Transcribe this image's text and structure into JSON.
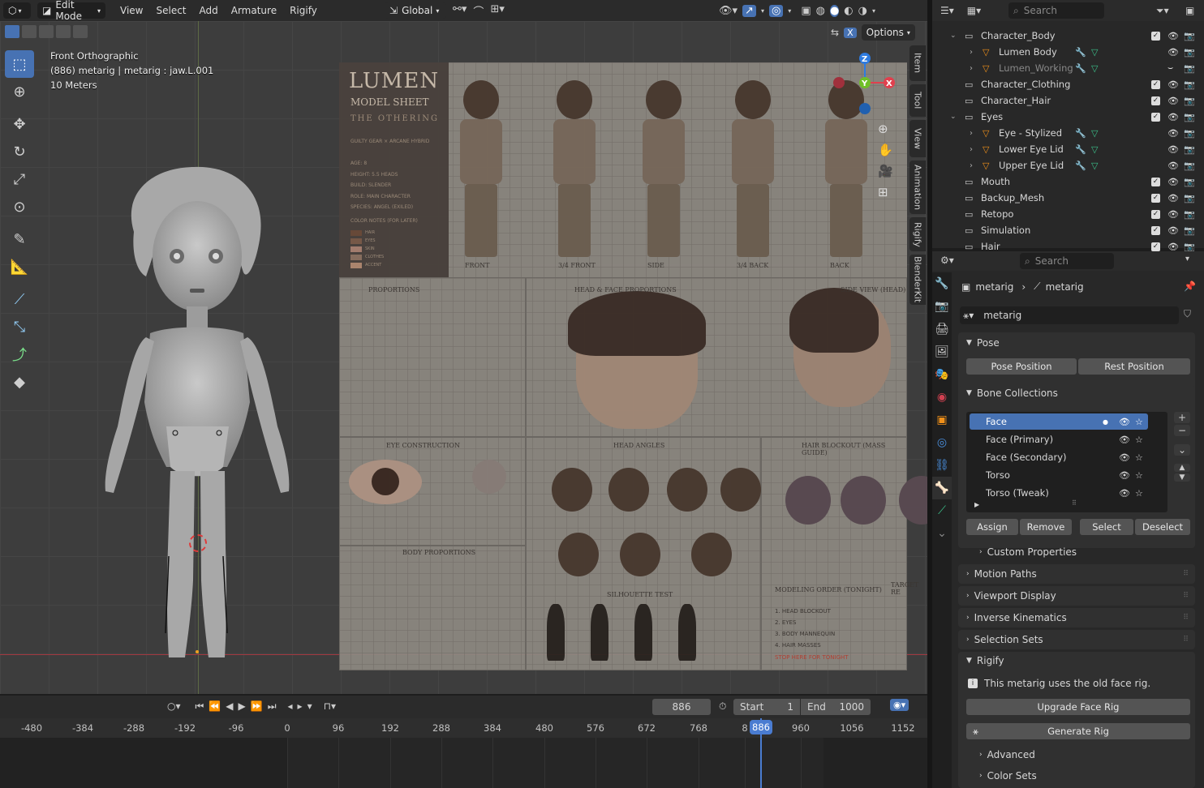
{
  "header": {
    "mode": "Edit Mode",
    "menus": [
      "View",
      "Select",
      "Add",
      "Armature",
      "Rigify"
    ],
    "transform_orientation": "Global",
    "options_label": "Options",
    "x_label": "X"
  },
  "viewport": {
    "view_name": "Front Orthographic",
    "object_info": "(886) metarig | metarig : jaw.L.001",
    "scale_info": "10 Meters",
    "side_tabs": [
      "Item",
      "Tool",
      "View",
      "Animation",
      "Rigify",
      "BlenderKit"
    ],
    "gizmo_axes": [
      "Z",
      "Y",
      "X"
    ]
  },
  "reference_sheet": {
    "title_line1": "LUMEN",
    "title_line2": "MODEL SHEET",
    "title_line3": "THE OTHERING",
    "subtitle": "GUILTY GEAR × ARCANE HYBRID",
    "specs": [
      "AGE: 8",
      "HEIGHT: 5.5 HEADS",
      "BUILD: SLENDER",
      "ROLE: MAIN CHARACTER",
      "SPECIES: ANGEL (EXILED)"
    ],
    "color_notes": "COLOR NOTES (FOR LATER)",
    "color_swatches": [
      "HAIR",
      "EYES",
      "SKIN",
      "CLOTHES",
      "ACCENT"
    ],
    "view_labels": [
      "FRONT",
      "3/4 FRONT",
      "SIDE",
      "3/4 BACK",
      "BACK"
    ],
    "panel_titles": [
      "PROPORTIONS",
      "HEAD & FACE PROPORTIONS",
      "SIDE VIEW (HEAD)",
      "EYE CONSTRUCTION",
      "HEAD ANGLES",
      "HAIR BLOCKOUT (MASS GUIDE)",
      "BODY PROPORTIONS",
      "SILHOUETTE TEST",
      "MODELING ORDER (TONIGHT)",
      "TARGET RE"
    ],
    "modeling_order": [
      "1. HEAD BLOCKOUT",
      "2. EYES",
      "3. BODY MANNEQUIN",
      "4. HAIR MASSES"
    ],
    "stop_text": "STOP HERE FOR TONIGHT"
  },
  "timeline": {
    "current_frame": "886",
    "start_label": "Start",
    "start_value": "1",
    "end_label": "End",
    "end_value": "1000",
    "ticks": [
      "-480",
      "-384",
      "-288",
      "-192",
      "-96",
      "0",
      "96",
      "192",
      "288",
      "384",
      "480",
      "576",
      "672",
      "768",
      "8",
      "960",
      "1056",
      "1152"
    ],
    "playhead": "886"
  },
  "outliner": {
    "search_placeholder": "Search",
    "items": [
      {
        "label": "Character_Body",
        "indent": 1,
        "type": "collection",
        "expanded": true
      },
      {
        "label": "Lumen Body",
        "indent": 2,
        "type": "mesh"
      },
      {
        "label": "Lumen_Working",
        "indent": 2,
        "type": "mesh",
        "muted": true
      },
      {
        "label": "Character_Clothing",
        "indent": 1,
        "type": "collection"
      },
      {
        "label": "Character_Hair",
        "indent": 1,
        "type": "collection"
      },
      {
        "label": "Eyes",
        "indent": 1,
        "type": "collection",
        "expanded": true
      },
      {
        "label": "Eye - Stylized",
        "indent": 2,
        "type": "mesh"
      },
      {
        "label": "Lower Eye Lid",
        "indent": 2,
        "type": "mesh"
      },
      {
        "label": "Upper Eye Lid",
        "indent": 2,
        "type": "mesh"
      },
      {
        "label": "Mouth",
        "indent": 1,
        "type": "collection"
      },
      {
        "label": "Backup_Mesh",
        "indent": 1,
        "type": "collection"
      },
      {
        "label": "Retopo",
        "indent": 1,
        "type": "collection"
      },
      {
        "label": "Simulation",
        "indent": 1,
        "type": "collection"
      },
      {
        "label": "Hair",
        "indent": 1,
        "type": "collection"
      }
    ]
  },
  "properties": {
    "search_placeholder": "Search",
    "breadcrumb_object": "metarig",
    "breadcrumb_data": "metarig",
    "data_name": "metarig",
    "pose_section": "Pose",
    "pose_position": "Pose Position",
    "rest_position": "Rest Position",
    "bone_collections_section": "Bone Collections",
    "bone_collections": [
      "Face",
      "Face (Primary)",
      "Face (Secondary)",
      "Torso",
      "Torso (Tweak)"
    ],
    "assign": "Assign",
    "remove": "Remove",
    "select": "Select",
    "deselect": "Deselect",
    "custom_properties": "Custom Properties",
    "motion_paths": "Motion Paths",
    "viewport_display": "Viewport Display",
    "inverse_kinematics": "Inverse Kinematics",
    "selection_sets": "Selection Sets",
    "rigify_section": "Rigify",
    "rigify_info": "This metarig uses the old face rig.",
    "upgrade_face_rig": "Upgrade Face Rig",
    "generate_rig": "Generate Rig",
    "advanced": "Advanced",
    "color_sets": "Color Sets"
  },
  "colors": {
    "accent_blue": "#4772b3",
    "playhead_blue": "#4a7cd1",
    "axis_x": "#e0404e",
    "axis_y": "#6fbf28",
    "axis_z": "#2e7be0"
  }
}
